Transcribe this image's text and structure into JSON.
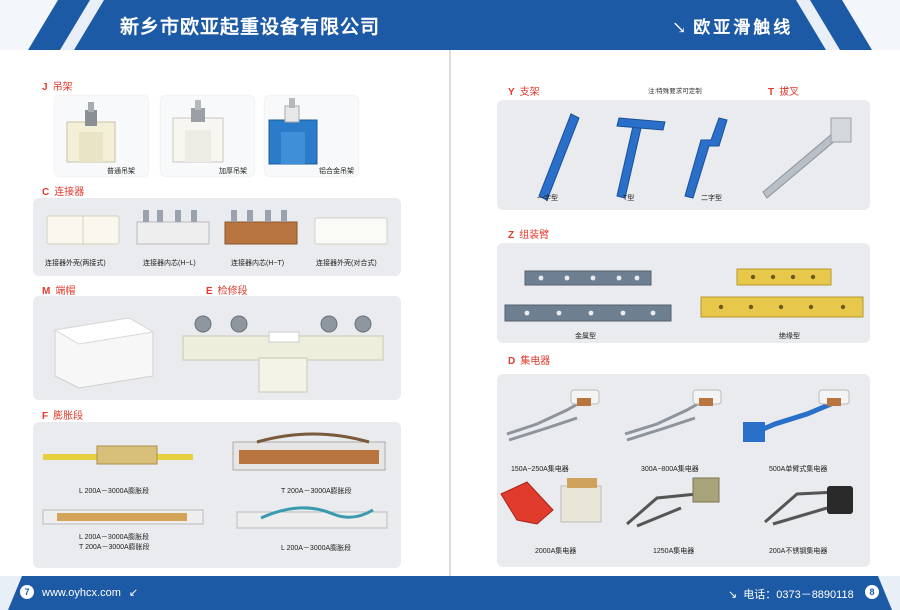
{
  "header": {
    "left_title": "新乡市欧亚起重设备有限公司",
    "right_title": "欧亚滑触线",
    "color": "#1d5aa6"
  },
  "footer": {
    "left_page": "7",
    "website": "www.oyhcx.com",
    "phone": "电话：0373－8890118",
    "right_page": "8"
  },
  "sections": {
    "j": {
      "letter": "J",
      "name": "吊架",
      "items": [
        "普通吊架",
        "加厚吊架",
        "铝合金吊架"
      ]
    },
    "c": {
      "letter": "C",
      "name": "连接器",
      "items": [
        "连接器外壳(两接式)",
        "连接器内芯(H−L)",
        "连接器内芯(H−T)",
        "连接器外壳(对合式)"
      ]
    },
    "m": {
      "letter": "M",
      "name": "端帽"
    },
    "e": {
      "letter": "E",
      "name": "检修段"
    },
    "f": {
      "letter": "F",
      "name": "膨胀段",
      "items": [
        "L 200A－3000A膨胀段",
        "T 200A－3000A膨胀段",
        "L 200A－3000A膨胀段",
        "T 200A－3000A膨胀段",
        "L 200A－3000A膨胀段"
      ]
    },
    "y": {
      "letter": "Y",
      "name": "支架",
      "note": "注:特殊要求可定制",
      "items": [
        "一字型",
        "T型",
        "二字型"
      ]
    },
    "t": {
      "letter": "T",
      "name": "拔叉"
    },
    "z": {
      "letter": "Z",
      "name": "组装臂",
      "items": [
        "金属型",
        "绝缘型"
      ]
    },
    "d": {
      "letter": "D",
      "name": "集电器",
      "items": [
        "150A−250A集电器",
        "300A−800A集电器",
        "500A单臂式集电器",
        "2000A集电器",
        "1250A集电器",
        "200A不锈钢集电器"
      ]
    }
  },
  "colors": {
    "accent_red": "#e23a2c",
    "panel_gray": "#e9ebee",
    "bracket_blue": "#2a6fc9",
    "insulator_yellow": "#e8c84a",
    "copper": "#b8753f"
  }
}
